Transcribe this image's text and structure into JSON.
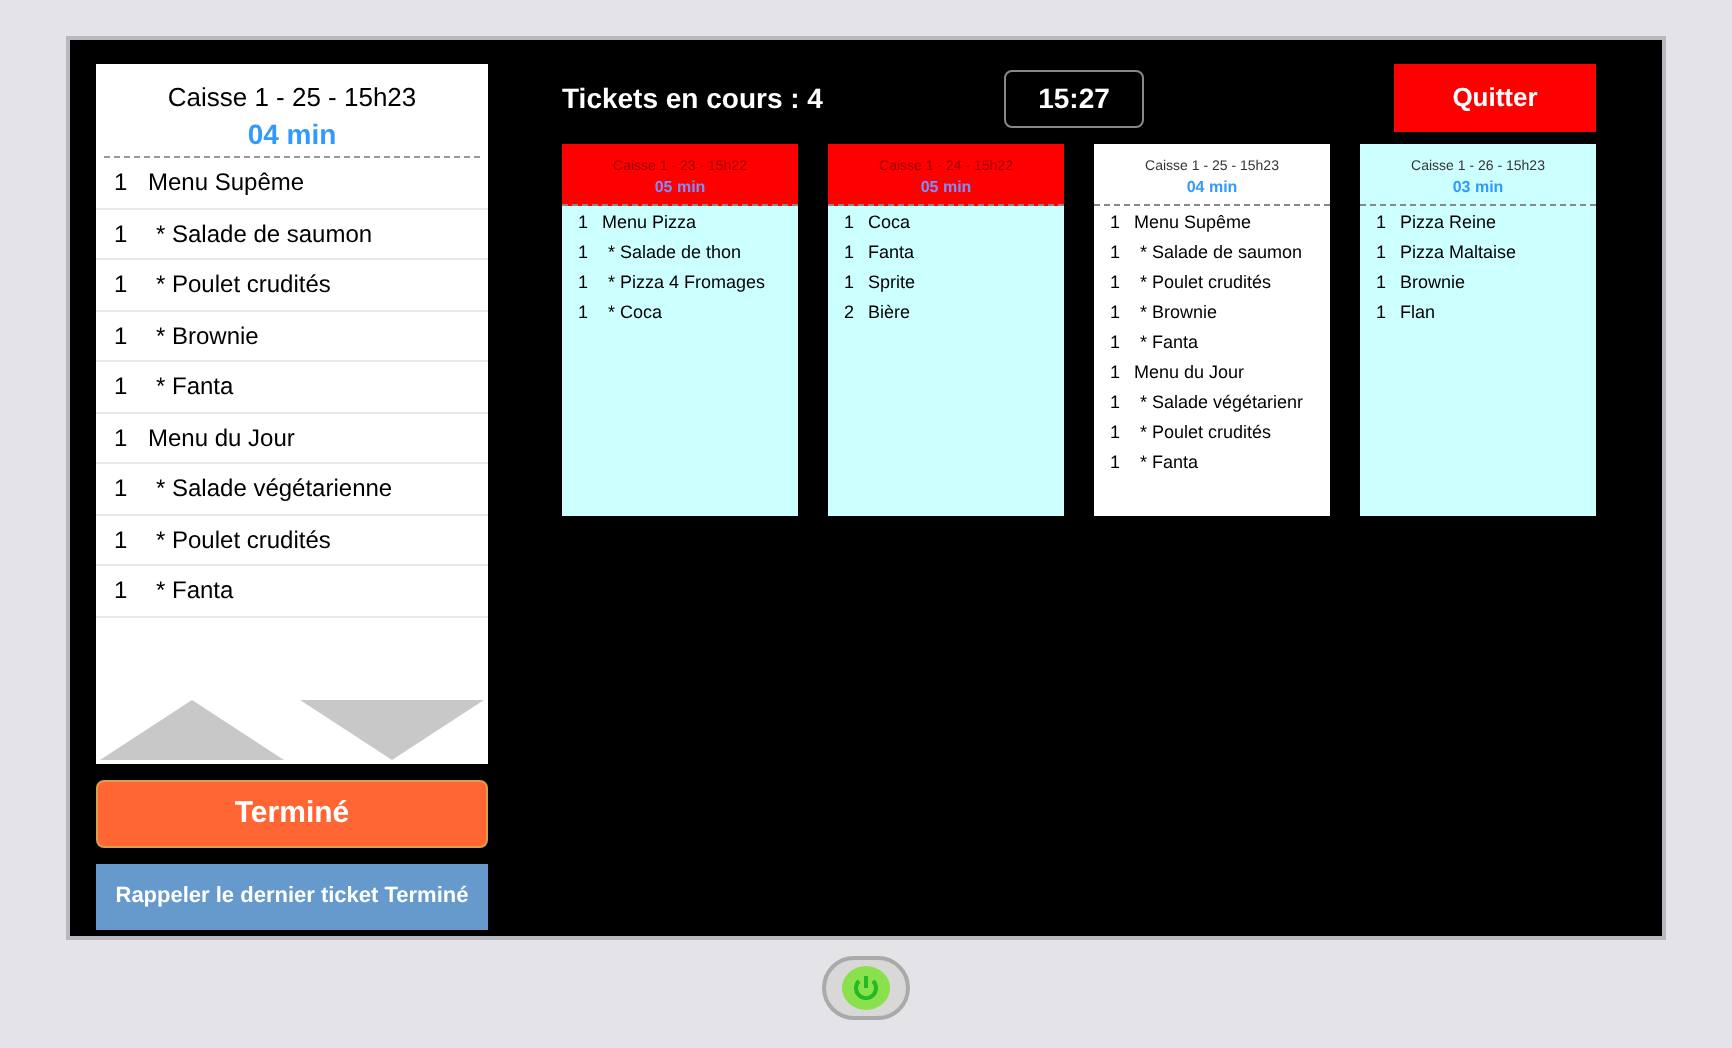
{
  "current_ticket": {
    "title": "Caisse 1 - 25 - 15h23",
    "elapsed": "04 min",
    "items": [
      {
        "qty": "1",
        "kind": "main",
        "name": "Menu Supême"
      },
      {
        "qty": "1",
        "kind": "sub",
        "name": "* Salade de saumon"
      },
      {
        "qty": "1",
        "kind": "sub",
        "name": "* Poulet crudités"
      },
      {
        "qty": "1",
        "kind": "sub",
        "name": "* Brownie"
      },
      {
        "qty": "1",
        "kind": "sub",
        "name": "* Fanta"
      },
      {
        "qty": "1",
        "kind": "main",
        "name": "Menu du Jour"
      },
      {
        "qty": "1",
        "kind": "sub",
        "name": "* Salade végétarienne"
      },
      {
        "qty": "1",
        "kind": "sub",
        "name": "* Poulet crudités"
      },
      {
        "qty": "1",
        "kind": "sub",
        "name": "* Fanta"
      }
    ]
  },
  "done_button": "Terminé",
  "recall_button": "Rappeler le dernier ticket Terminé",
  "tickets_count": "Tickets en cours : 4",
  "clock": "15:27",
  "quit_button": "Quitter",
  "tickets": [
    {
      "title": "Caisse 1 - 23 - 15h22",
      "elapsed": "05 min",
      "late": true,
      "selected": false,
      "items": [
        {
          "qty": "1",
          "kind": "main",
          "name": "Menu Pizza"
        },
        {
          "qty": "1",
          "kind": "sub",
          "name": "* Salade de thon"
        },
        {
          "qty": "1",
          "kind": "sub",
          "name": "* Pizza 4 Fromages"
        },
        {
          "qty": "1",
          "kind": "sub",
          "name": "* Coca"
        }
      ]
    },
    {
      "title": "Caisse 1 - 24 - 15h22",
      "elapsed": "05 min",
      "late": true,
      "selected": false,
      "items": [
        {
          "qty": "1",
          "kind": "main",
          "name": "Coca"
        },
        {
          "qty": "1",
          "kind": "main",
          "name": "Fanta"
        },
        {
          "qty": "1",
          "kind": "main",
          "name": "Sprite"
        },
        {
          "qty": "2",
          "kind": "main",
          "name": "Bière"
        }
      ]
    },
    {
      "title": "Caisse 1 - 25 - 15h23",
      "elapsed": "04 min",
      "late": false,
      "selected": true,
      "items": [
        {
          "qty": "1",
          "kind": "main",
          "name": "Menu Supême"
        },
        {
          "qty": "1",
          "kind": "sub",
          "name": "* Salade de saumon"
        },
        {
          "qty": "1",
          "kind": "sub",
          "name": "* Poulet crudités"
        },
        {
          "qty": "1",
          "kind": "sub",
          "name": "* Brownie"
        },
        {
          "qty": "1",
          "kind": "sub",
          "name": "* Fanta"
        },
        {
          "qty": "1",
          "kind": "main",
          "name": "Menu du Jour"
        },
        {
          "qty": "1",
          "kind": "sub",
          "name": "* Salade végétarienr"
        },
        {
          "qty": "1",
          "kind": "sub",
          "name": "* Poulet crudités"
        },
        {
          "qty": "1",
          "kind": "sub",
          "name": "* Fanta"
        }
      ]
    },
    {
      "title": "Caisse 1 - 26 - 15h23",
      "elapsed": "03 min",
      "late": false,
      "selected": false,
      "items": [
        {
          "qty": "1",
          "kind": "main",
          "name": "Pizza Reine"
        },
        {
          "qty": "1",
          "kind": "main",
          "name": "Pizza Maltaise"
        },
        {
          "qty": "1",
          "kind": "main",
          "name": "Brownie"
        },
        {
          "qty": "1",
          "kind": "main",
          "name": "Flan"
        }
      ]
    }
  ]
}
